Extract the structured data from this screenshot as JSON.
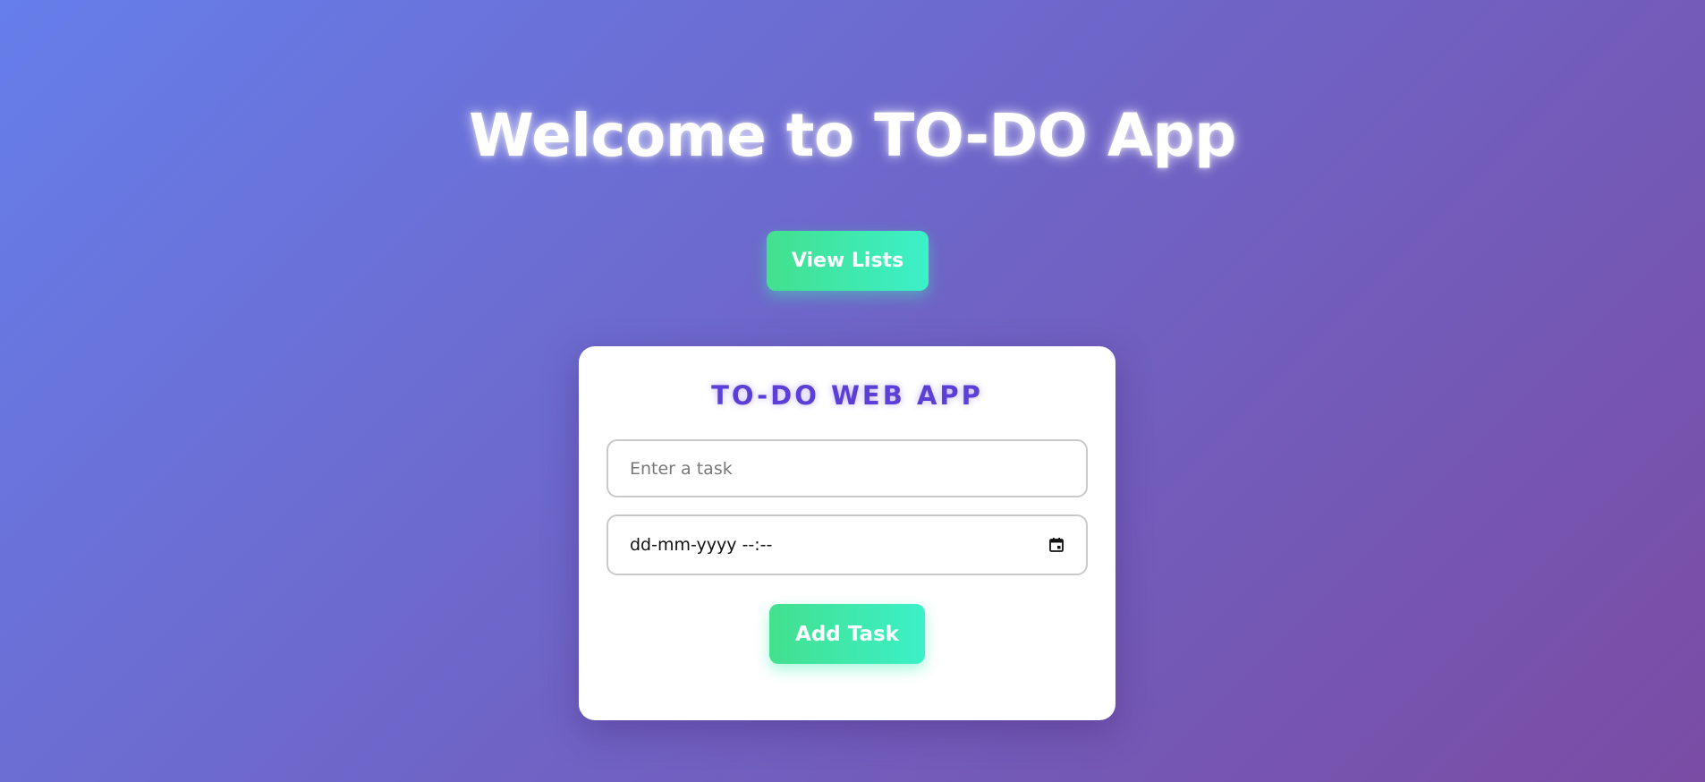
{
  "header": {
    "title": "Welcome to TO-DO App"
  },
  "actions": {
    "view_lists_label": "View Lists"
  },
  "card": {
    "title": "TO-DO WEB APP",
    "task_input": {
      "value": "",
      "placeholder": "Enter a task"
    },
    "datetime_input": {
      "display_value": "dd-mm-yyyy --:--",
      "icon": "calendar-icon"
    },
    "add_task_label": "Add Task"
  },
  "colors": {
    "background_start": "#667eea",
    "background_end": "#7a4ca4",
    "button_gradient_start": "#43e08e",
    "button_gradient_end": "#3cf0c8",
    "card_title": "#5b3fd6",
    "card_background": "#ffffff"
  }
}
